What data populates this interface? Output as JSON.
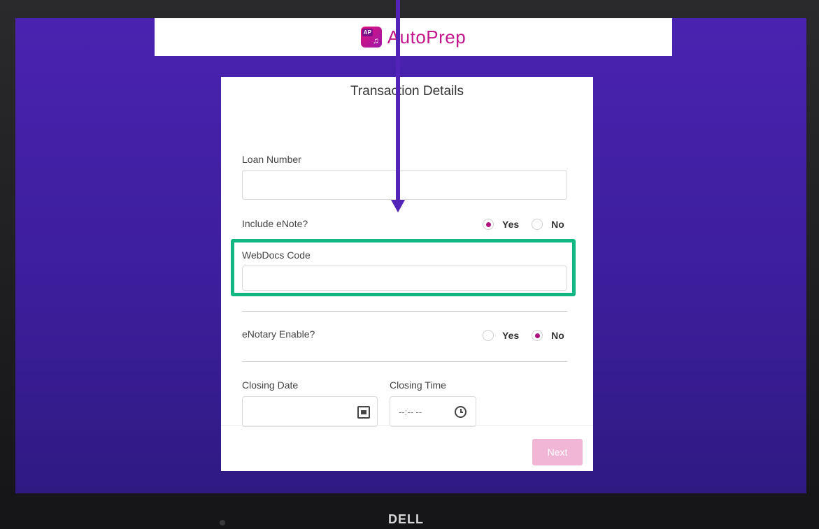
{
  "app": {
    "name": "AutoPrep",
    "logo_badge": "AP"
  },
  "form": {
    "title": "Transaction Details",
    "loan_number": {
      "label": "Loan Number",
      "value": ""
    },
    "include_enote": {
      "label": "Include eNote?",
      "options": [
        "Yes",
        "No"
      ],
      "selected": "Yes"
    },
    "webdocs_code": {
      "label": "WebDocs Code",
      "value": ""
    },
    "enotary_enable": {
      "label": "eNotary Enable?",
      "options": [
        "Yes",
        "No"
      ],
      "selected": "No"
    },
    "closing_date": {
      "label": "Closing Date",
      "value": ""
    },
    "closing_time": {
      "label": "Closing Time",
      "placeholder": "--:-- --"
    },
    "next_label": "Next"
  },
  "device": {
    "brand": "DELL"
  },
  "colors": {
    "accent": "#b0117d",
    "brand_text": "#c4168c",
    "background_top": "#4a22b0",
    "highlight": "#12b783",
    "next_disabled": "#f1b6d6"
  },
  "icons": {
    "logo": "autoprep-logo-icon",
    "date": "calendar-icon",
    "time": "clock-icon",
    "annotation": "arrow-down-icon"
  }
}
